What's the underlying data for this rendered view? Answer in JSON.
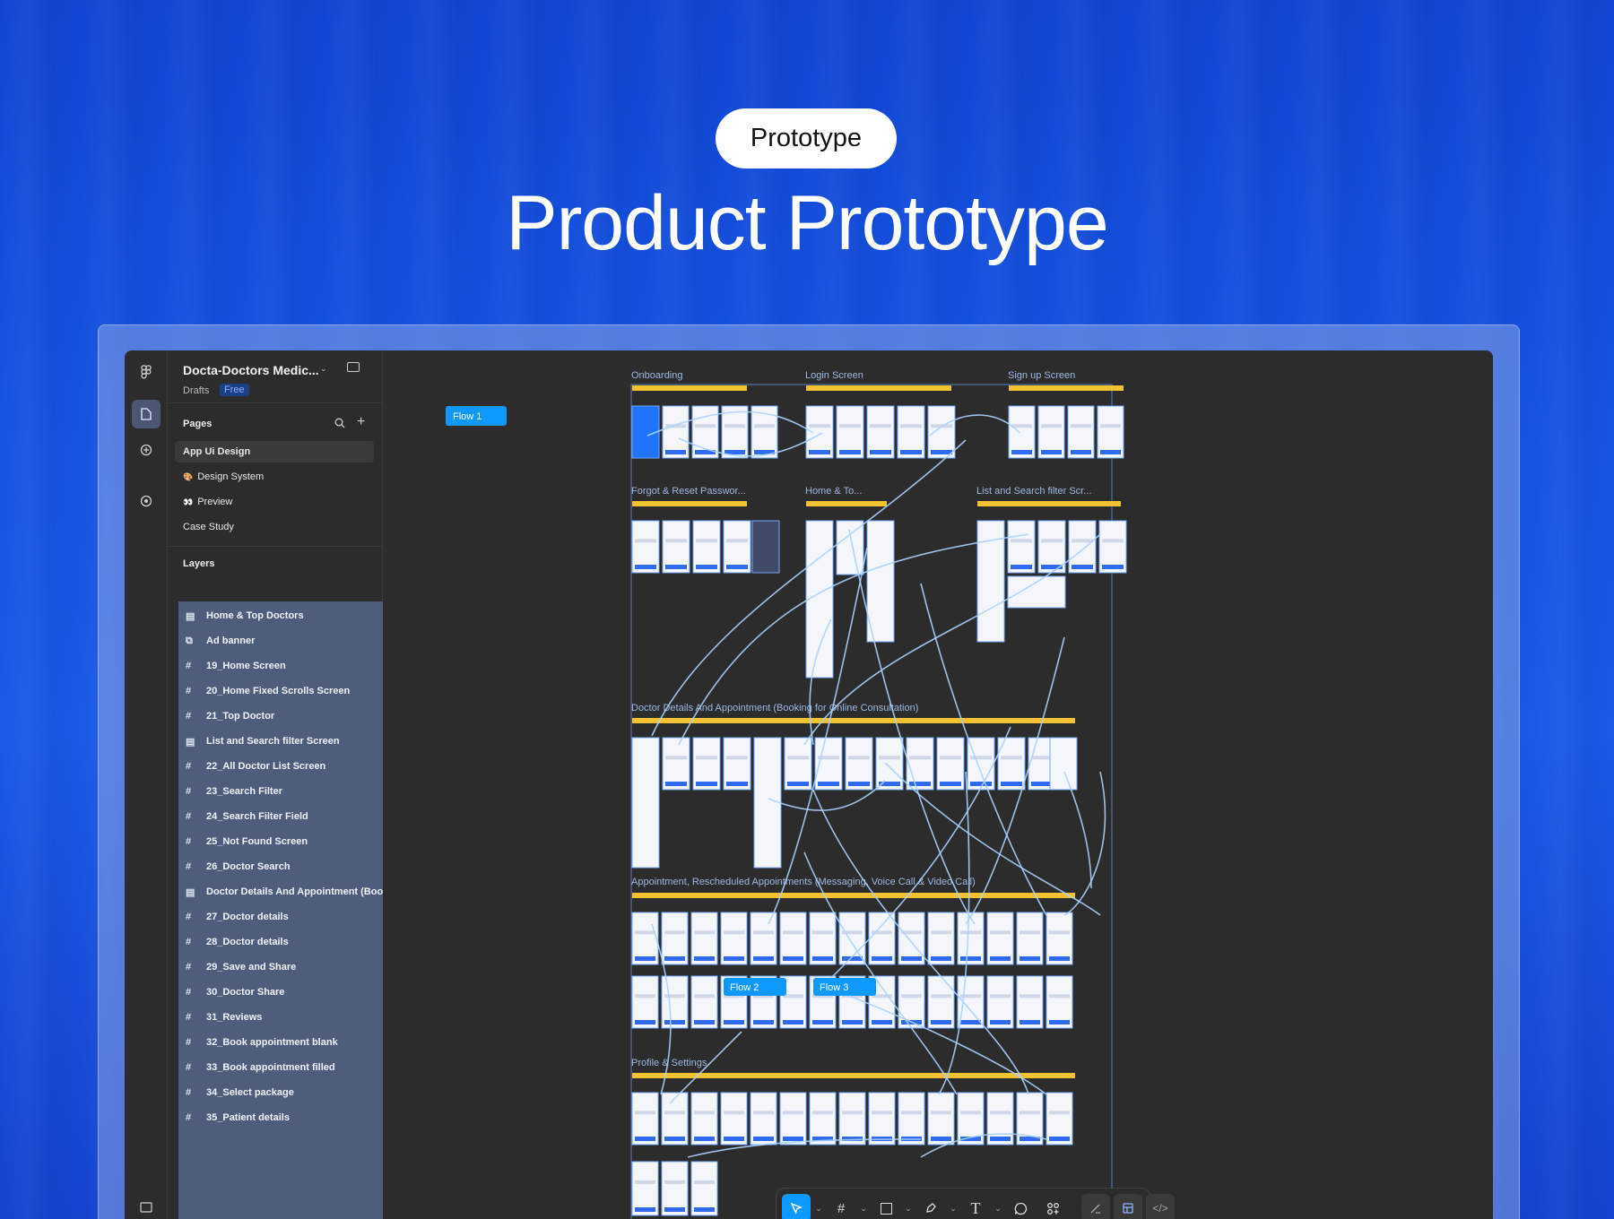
{
  "hero": {
    "pill": "Prototype",
    "headline": "Product Prototype"
  },
  "file": {
    "title": "Docta-Doctors Medic...",
    "location": "Drafts",
    "plan": "Free"
  },
  "pages": {
    "header": "Pages",
    "items": [
      {
        "label": "App Ui Design",
        "selected": true
      },
      {
        "label": "Design System",
        "icon": "🎨"
      },
      {
        "label": "Preview",
        "icon": "👀"
      },
      {
        "label": "Case Study"
      }
    ]
  },
  "layers": {
    "header": "Layers",
    "items": [
      {
        "label": "Home & Top Doctors",
        "icon": "section-icon"
      },
      {
        "label": "Ad banner",
        "icon": "component-icon"
      },
      {
        "label": "19_Home Screen",
        "icon": "frame-icon"
      },
      {
        "label": "20_Home Fixed Scrolls Screen",
        "icon": "frame-icon"
      },
      {
        "label": "21_Top Doctor",
        "icon": "frame-icon"
      },
      {
        "label": "List and Search filter Screen",
        "icon": "section-icon"
      },
      {
        "label": "22_All Doctor List Screen",
        "icon": "frame-icon"
      },
      {
        "label": "23_Search Filter",
        "icon": "frame-icon"
      },
      {
        "label": "24_Search Filter Field",
        "icon": "frame-icon"
      },
      {
        "label": "25_Not Found Screen",
        "icon": "frame-icon"
      },
      {
        "label": "26_Doctor Search",
        "icon": "frame-icon"
      },
      {
        "label": "Doctor Details And Appointment (Boo",
        "icon": "section-icon"
      },
      {
        "label": "27_Doctor details",
        "icon": "frame-icon"
      },
      {
        "label": "28_Doctor details",
        "icon": "frame-icon"
      },
      {
        "label": "29_Save and Share",
        "icon": "frame-icon"
      },
      {
        "label": "30_Doctor Share",
        "icon": "frame-icon"
      },
      {
        "label": "31_Reviews",
        "icon": "frame-icon"
      },
      {
        "label": "32_Book appointment blank",
        "icon": "frame-icon"
      },
      {
        "label": "33_Book appointment filled",
        "icon": "frame-icon"
      },
      {
        "label": "34_Select package",
        "icon": "frame-icon"
      },
      {
        "label": "35_Patient details",
        "icon": "frame-icon"
      }
    ]
  },
  "canvas": {
    "sections": [
      "Onboarding",
      "Login Screen",
      "Sign up Screen",
      "Forgot & Reset Passwor...",
      "Home & To...",
      "List and Search filter Scr...",
      "Doctor Details And Appointment (Booking for Online Consultation)",
      "Appointment, Rescheduled Appointments (Messaging, Voice Call & Video Call)",
      "Profile & Settings"
    ],
    "flows": [
      "Flow 1",
      "Flow 2",
      "Flow 3"
    ]
  },
  "colors": {
    "accent": "#0d99ff",
    "wire": "#a9d2ff",
    "section_bar": "#f2c230"
  }
}
